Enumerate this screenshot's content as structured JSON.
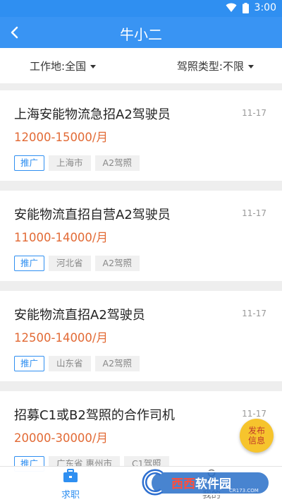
{
  "status_bar": {
    "time": "3:00"
  },
  "app_bar": {
    "title": "牛小二",
    "back_icon": "back-arrow-icon"
  },
  "filters": {
    "location": {
      "label": "工作地:",
      "value": "全国"
    },
    "license": {
      "label": "驾照类型:",
      "value": "不限"
    }
  },
  "jobs": [
    {
      "title": "上海安能物流急招A2驾驶员",
      "date": "11-17",
      "salary": "12000-15000/月",
      "tags": [
        "推广",
        "上海市",
        "A2驾照"
      ]
    },
    {
      "title": "安能物流直招自营A2驾驶员",
      "date": "11-17",
      "salary": "11000-14000/月",
      "tags": [
        "推广",
        "河北省",
        "A2驾照"
      ]
    },
    {
      "title": "安能物流直招A2驾驶员",
      "date": "11-17",
      "salary": "12500-14000/月",
      "tags": [
        "推广",
        "山东省",
        "A2驾照"
      ]
    },
    {
      "title": "招募C1或B2驾照的合作司机",
      "date": "11-17",
      "salary": "20000-30000/月",
      "tags": [
        "推广",
        "广东省 惠州市",
        "C1驾照"
      ]
    }
  ],
  "fab": {
    "line1": "发布",
    "line2": "信息"
  },
  "bottom_nav": {
    "jobs": {
      "label": "求职",
      "icon": "briefcase-icon"
    },
    "me": {
      "label": "我的",
      "icon": "person-icon"
    }
  },
  "watermark": {
    "text_a": "西西",
    "text_b": "软件园",
    "url": "CR173.COM"
  },
  "colors": {
    "primary": "#3994f3",
    "salary": "#e26a35",
    "fab": "#f6c42d"
  }
}
